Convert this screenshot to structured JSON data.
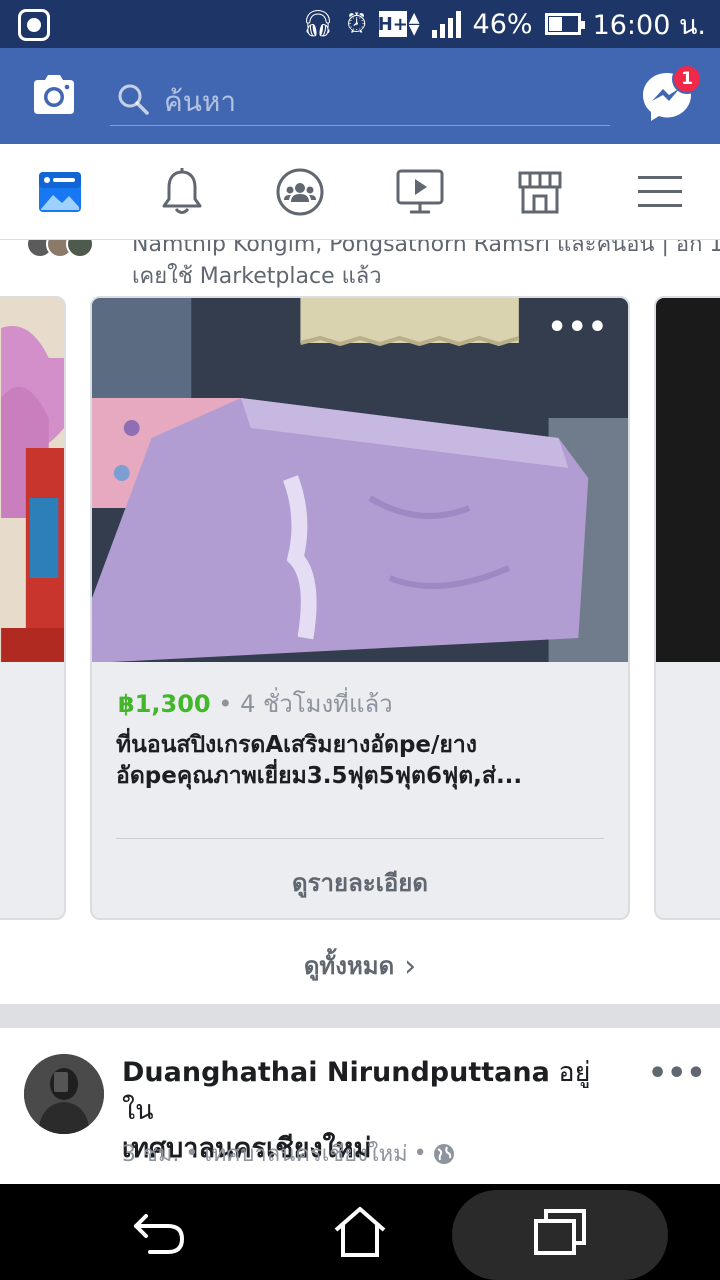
{
  "status_bar": {
    "time": "16:00 น.",
    "battery": "46%",
    "network": "H+"
  },
  "header": {
    "search_placeholder": "ค้นหา",
    "messenger_badge": "1"
  },
  "nav_tabs": [
    {
      "name": "news-feed",
      "icon": "news-feed-icon"
    },
    {
      "name": "notifications",
      "icon": "bell-icon"
    },
    {
      "name": "groups",
      "icon": "groups-icon"
    },
    {
      "name": "watch",
      "icon": "video-icon"
    },
    {
      "name": "marketplace",
      "icon": "shop-icon"
    },
    {
      "name": "menu",
      "icon": "hamburger-icon"
    }
  ],
  "marketplace": {
    "social_line_1": "Namthip Kongim, Pongsathorn Ramsri และคนอื่น | อีก 1...",
    "social_line_2": "เคยใช้ Marketplace แล้ว",
    "item": {
      "price": "฿1,300",
      "separator": "•",
      "posted": "4 ชั่วโมงที่แล้ว",
      "title": "ที่นอนสปิงเกรดAเสริมยางอัดpe/ยางอัดpeคุณภาพเยี่ยม3.5ฟุต5ฟุต6ฟุต,ส่...",
      "details_button": "ดูรายละเอียด"
    },
    "see_all": "ดูทั้งหมด"
  },
  "post": {
    "author": "Duanghathai Nirundputtana",
    "location_prefix": "อยู่ใน",
    "location": "เทศบาลนครเชียงใหม่",
    "time": "3 ชม.",
    "meta_location": "เทศบาลนครเชียงใหม่",
    "dot": "•",
    "more": "•••"
  },
  "colors": {
    "status_bar": "#1d3667",
    "brand_blue": "#4267b2",
    "price_green": "#42b72a",
    "badge_red": "#f02849"
  }
}
